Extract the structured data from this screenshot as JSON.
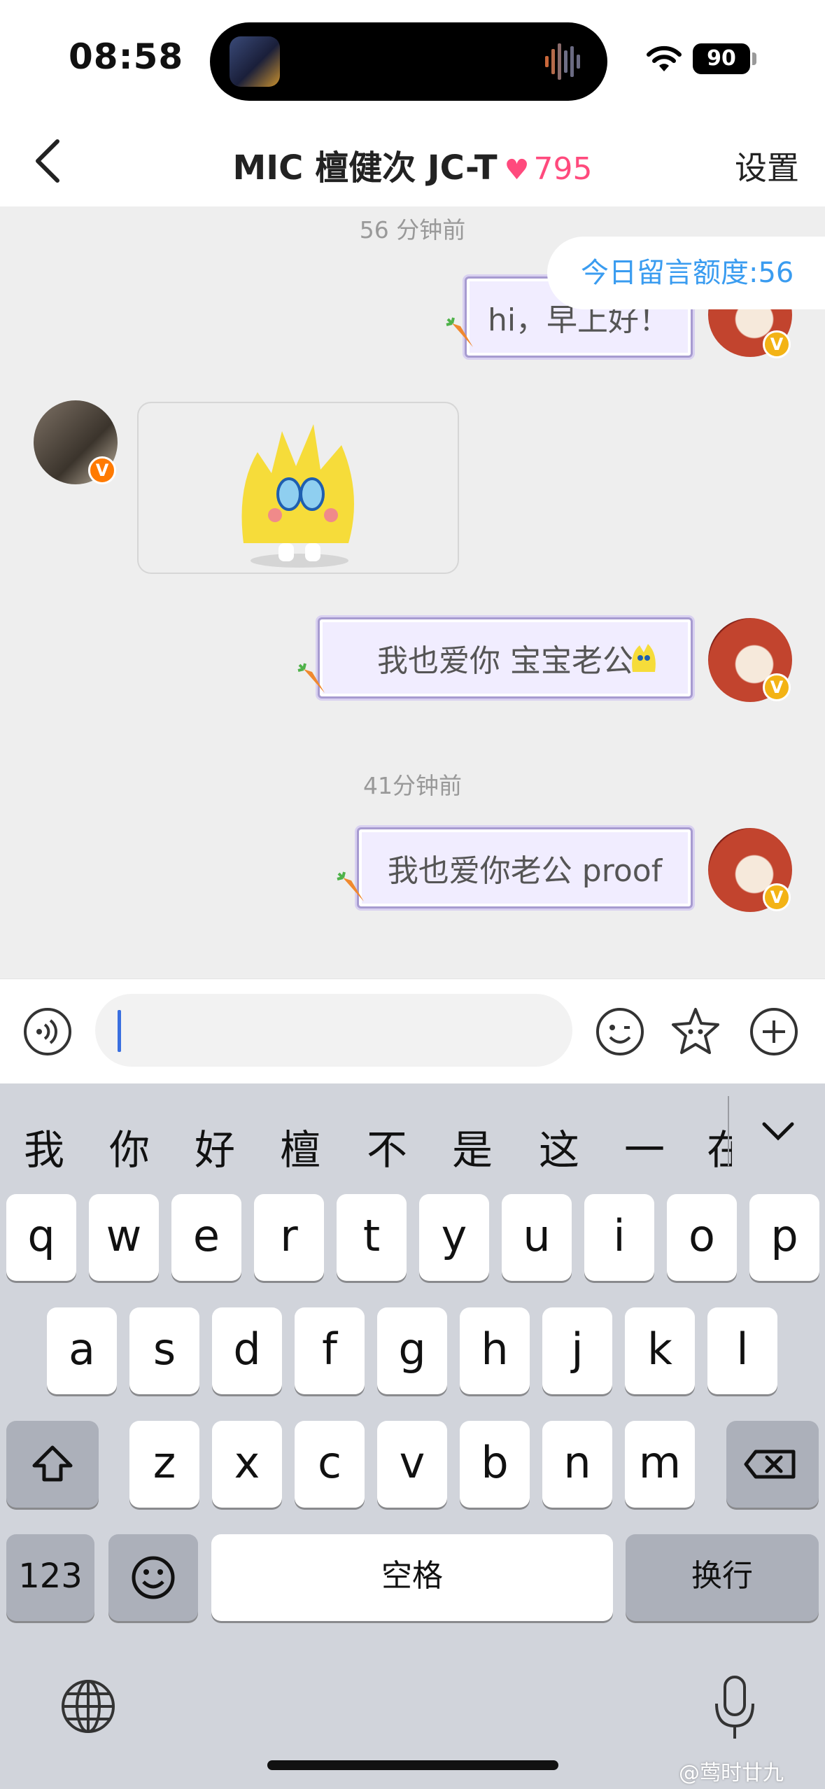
{
  "status": {
    "time": "08:58",
    "battery": "90"
  },
  "header": {
    "title": "MIC 檀健次 JC-T",
    "heart": "♥",
    "count": "795",
    "settings": "设置"
  },
  "chat": {
    "ts1": "56 分钟前",
    "quota": "今日留言额度:56",
    "msg1": "hi，早上好！",
    "msg2": "我也爱你 宝宝老公",
    "ts2": "41分钟前",
    "msg3": "我也爱你老公 proof"
  },
  "icons": [
    "back-icon",
    "voice-icon",
    "emoji-icon",
    "sticker-star-icon",
    "plus-icon",
    "shift-icon",
    "delete-icon",
    "keyboard-emoji-icon",
    "globe-icon",
    "mic-icon"
  ],
  "colors": {
    "accent_pink": "#ff4a7d",
    "quota_blue": "#3a9cf0",
    "bubble_fill": "#f1edff",
    "caret": "#3a6fe0"
  },
  "keyboard": {
    "candidates": [
      "我",
      "你",
      "好",
      "檀",
      "不",
      "是",
      "这",
      "一",
      "在"
    ],
    "row1": [
      "q",
      "w",
      "e",
      "r",
      "t",
      "y",
      "u",
      "i",
      "o",
      "p"
    ],
    "row2": [
      "a",
      "s",
      "d",
      "f",
      "g",
      "h",
      "j",
      "k",
      "l"
    ],
    "row3": [
      "z",
      "x",
      "c",
      "v",
      "b",
      "n",
      "m"
    ],
    "num": "123",
    "space": "空格",
    "return": "换行"
  },
  "watermark": "@莺时廿九"
}
